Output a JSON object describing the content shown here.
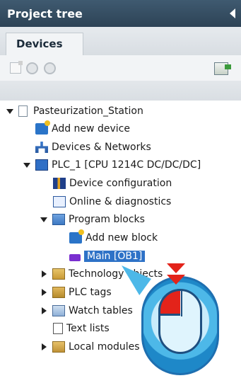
{
  "panel": {
    "title": "Project tree",
    "tab": "Devices"
  },
  "tree": {
    "root": "Pasteurization_Station",
    "add_new_device": "Add new device",
    "devices_networks": "Devices & Networks",
    "plc": "PLC_1 [CPU 1214C DC/DC/DC]",
    "device_configuration": "Device configuration",
    "online_diagnostics": "Online & diagnostics",
    "program_blocks": "Program blocks",
    "add_new_block": "Add new block",
    "main_block": "Main [OB1]",
    "technology_objects": "Technology objects",
    "plc_tags": "PLC tags",
    "watch_tables": "Watch tables",
    "text_lists": "Text lists",
    "local_modules": "Local modules"
  },
  "colors": {
    "header": "#2d4356",
    "selection": "#2e72c7",
    "callout": "#4db8e8",
    "mouse_button": "#e3231a"
  }
}
